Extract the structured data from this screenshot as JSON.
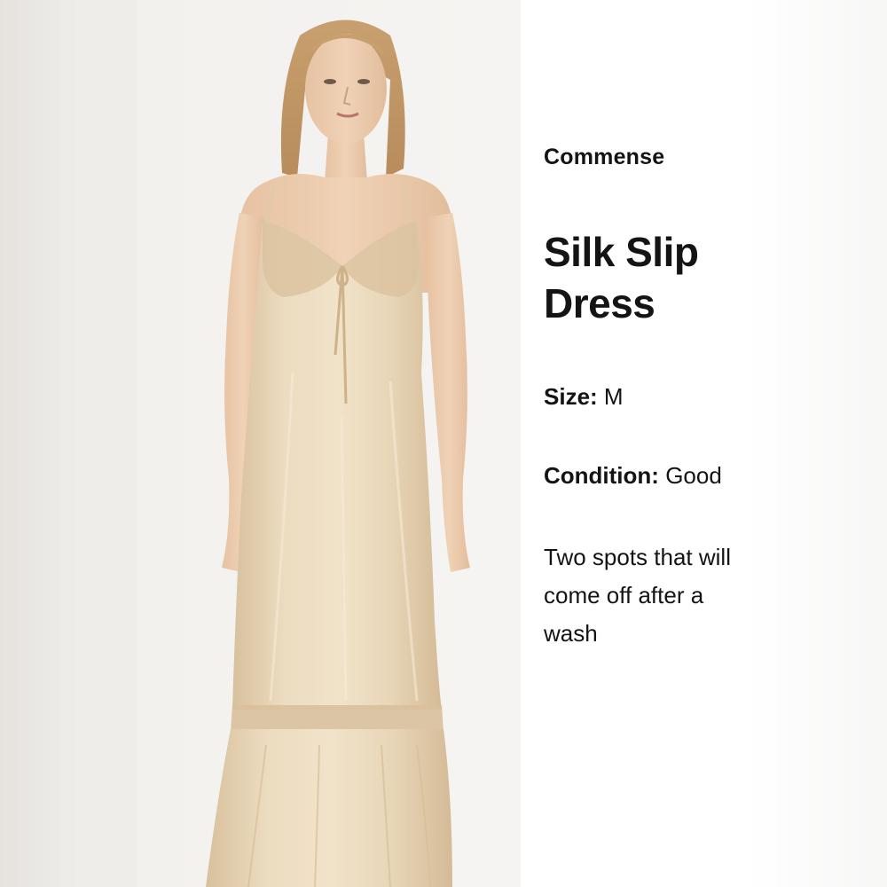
{
  "product": {
    "brand": "Commense",
    "title": "Silk Slip Dress",
    "size_label": "Size:",
    "size_value": "M",
    "condition_label": "Condition:",
    "condition_value": "Good",
    "note": "Two spots that will come off after a wash"
  },
  "photo": {
    "subject": "product-photo"
  },
  "colors": {
    "text": "#141414",
    "dress": "#e6d3b3",
    "background": "#f3f1ee"
  }
}
